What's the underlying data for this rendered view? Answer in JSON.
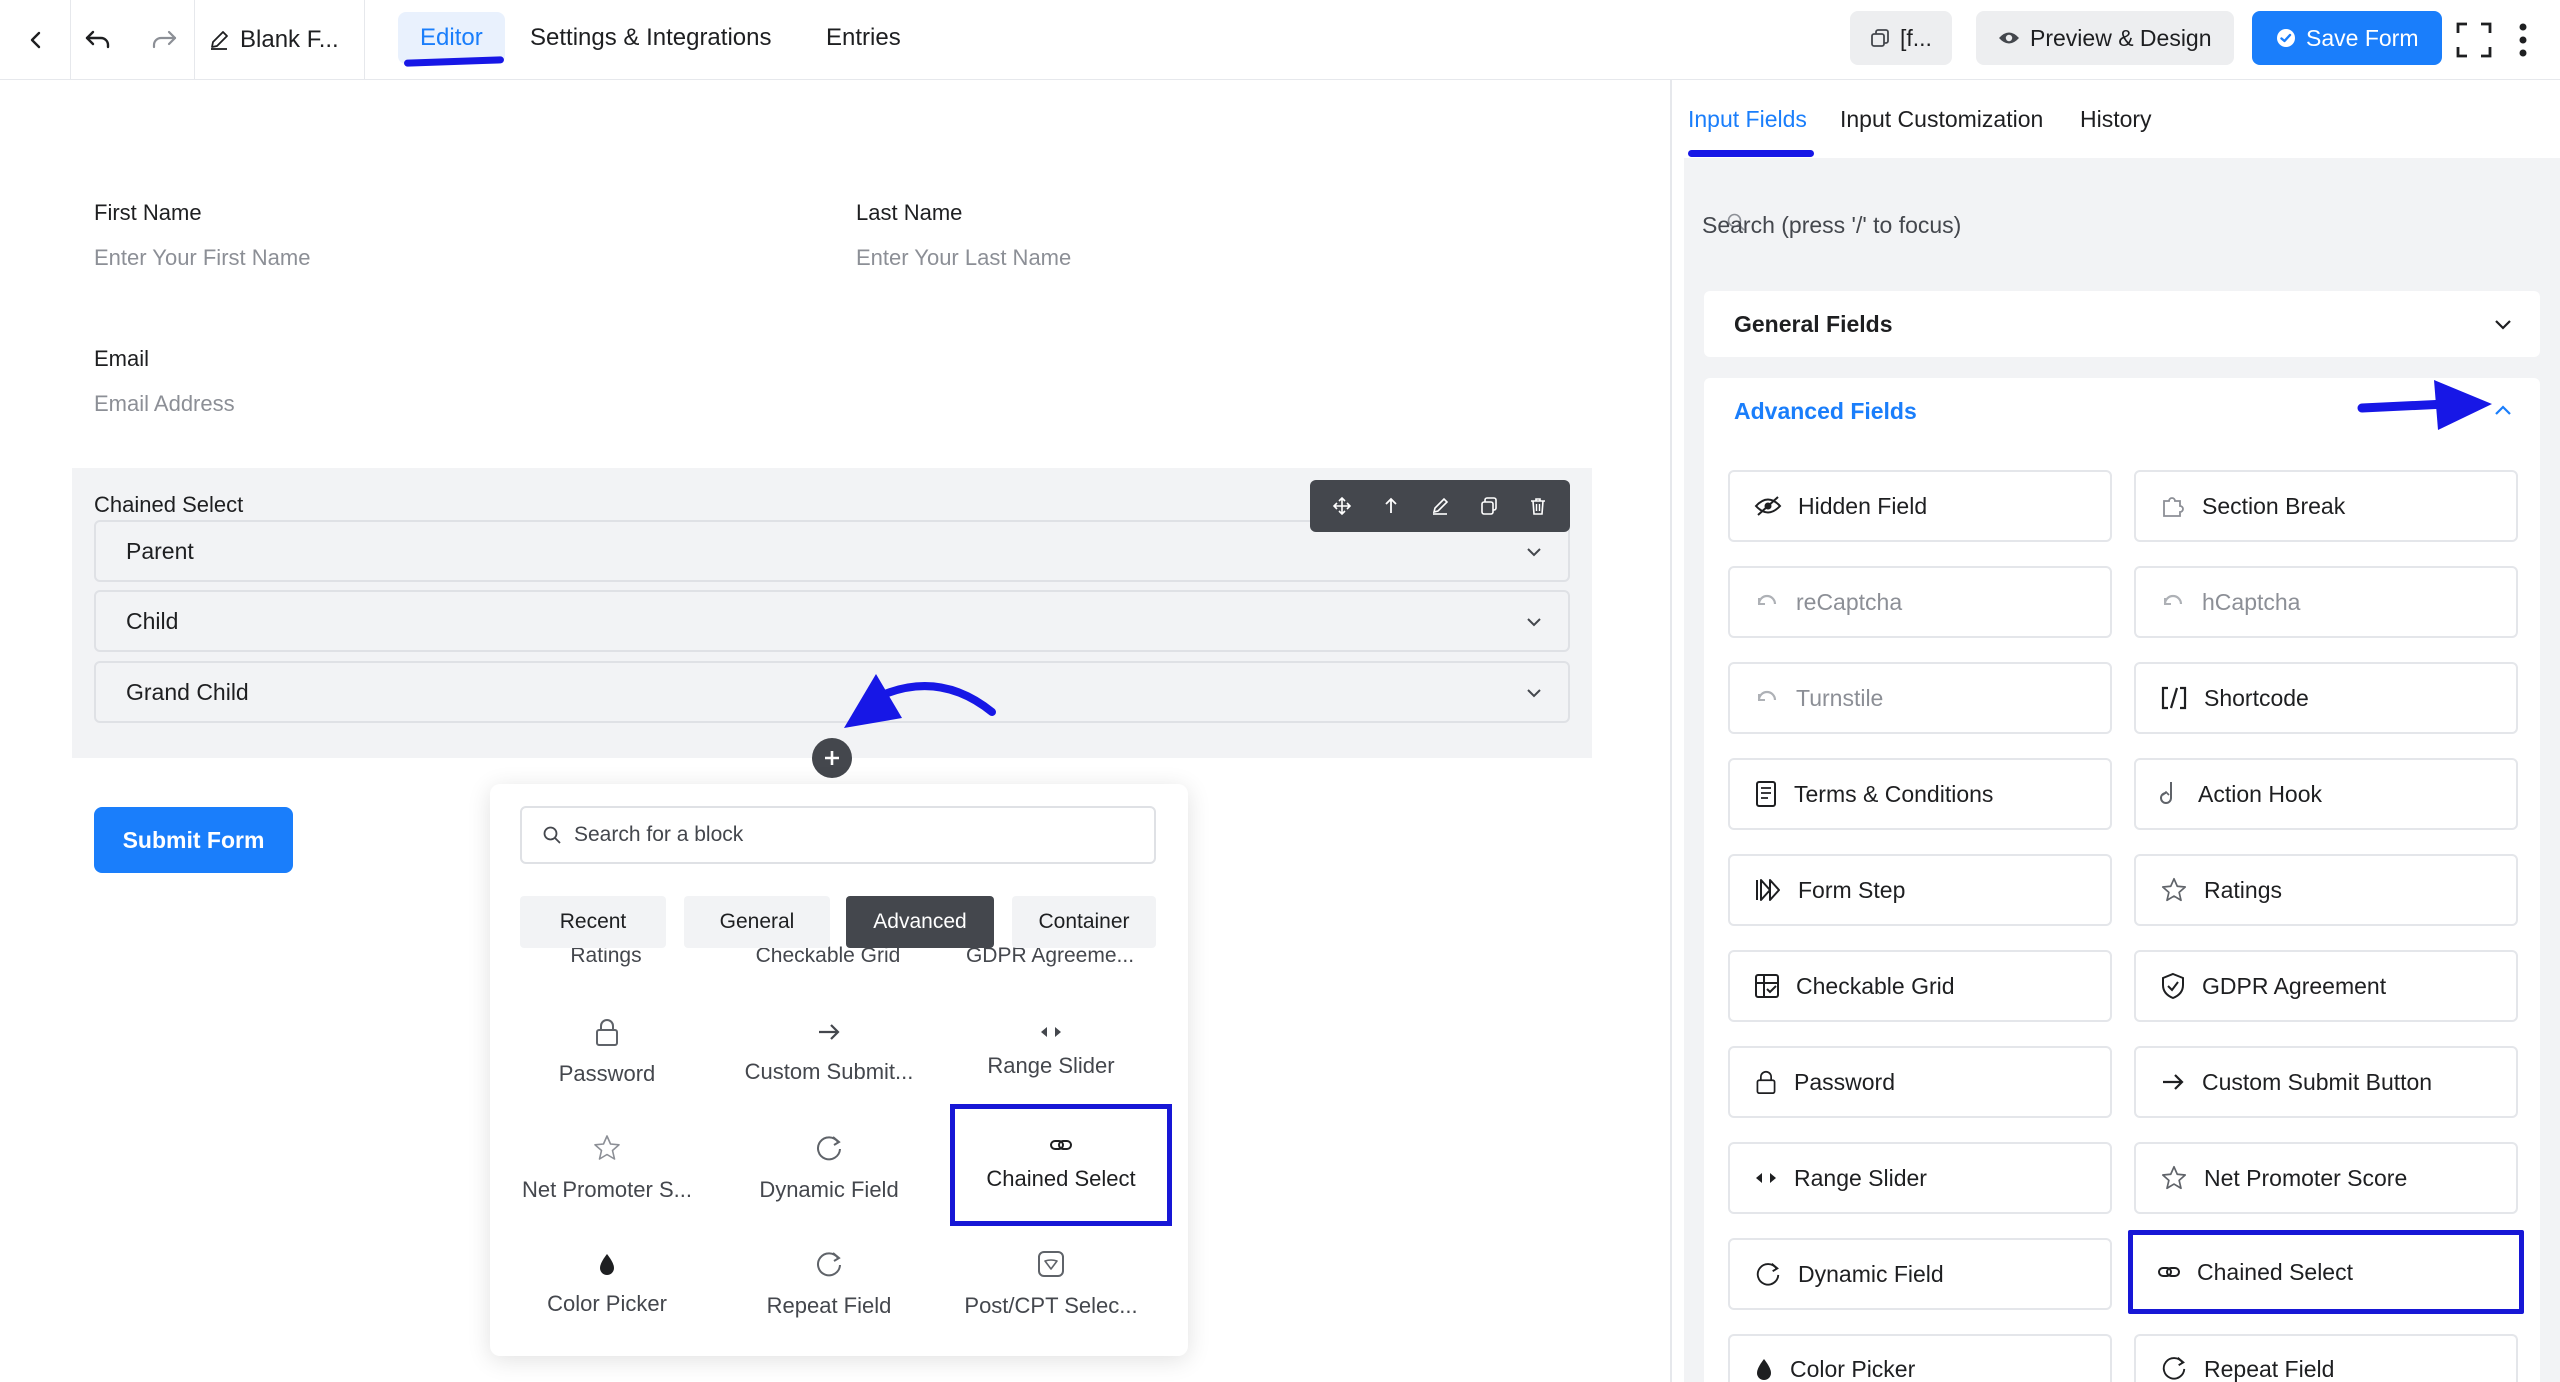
{
  "topbar": {
    "form_title": "Blank F...",
    "tabs": [
      "Editor",
      "Settings & Integrations",
      "Entries"
    ],
    "shortcode_label": "[f...",
    "preview_label": "Preview & Design",
    "save_label": "Save Form"
  },
  "form": {
    "first_name_label": "First Name",
    "first_name_placeholder": "Enter Your First Name",
    "last_name_label": "Last Name",
    "last_name_placeholder": "Enter Your Last Name",
    "email_label": "Email",
    "email_placeholder": "Email Address",
    "chained_label": "Chained Select",
    "selects": [
      "Parent",
      "Child",
      "Grand Child"
    ],
    "submit_label": "Submit Form"
  },
  "popup": {
    "search_placeholder": "Search for a block",
    "tabs": [
      "Recent",
      "General",
      "Advanced",
      "Container"
    ],
    "active_tab": "Advanced",
    "clipped_row": [
      "Ratings",
      "Checkable Grid",
      "GDPR Agreeme..."
    ],
    "items": [
      {
        "label": "Password",
        "icon": "lock-icon"
      },
      {
        "label": "Custom Submit...",
        "icon": "arrow-right-icon"
      },
      {
        "label": "Range Slider",
        "icon": "range-slider-icon"
      },
      {
        "label": "Net Promoter S...",
        "icon": "star-icon"
      },
      {
        "label": "Dynamic Field",
        "icon": "refresh-icon"
      },
      {
        "label": "Chained Select",
        "icon": "link-icon"
      },
      {
        "label": "Color Picker",
        "icon": "drop-icon"
      },
      {
        "label": "Repeat Field",
        "icon": "refresh-icon"
      },
      {
        "label": "Post/CPT Selec...",
        "icon": "post-select-icon"
      }
    ]
  },
  "sidebar": {
    "tabs": [
      "Input Fields",
      "Input Customization",
      "History"
    ],
    "search_placeholder": "Search (press '/' to focus)",
    "general_fields": "General Fields",
    "advanced_fields": "Advanced Fields",
    "items": [
      {
        "label": "Hidden Field",
        "icon": "eye-slash-icon",
        "disabled": false
      },
      {
        "label": "Section Break",
        "icon": "puzzle-icon",
        "disabled": false
      },
      {
        "label": "reCaptcha",
        "icon": "captcha-icon",
        "disabled": true
      },
      {
        "label": "hCaptcha",
        "icon": "captcha-icon",
        "disabled": true
      },
      {
        "label": "Turnstile",
        "icon": "captcha-icon",
        "disabled": true
      },
      {
        "label": "Shortcode",
        "icon": "shortcode-icon",
        "disabled": false
      },
      {
        "label": "Terms & Conditions",
        "icon": "document-icon",
        "disabled": false
      },
      {
        "label": "Action Hook",
        "icon": "hook-icon",
        "disabled": false
      },
      {
        "label": "Form Step",
        "icon": "step-icon",
        "disabled": false
      },
      {
        "label": "Ratings",
        "icon": "star-icon",
        "disabled": false
      },
      {
        "label": "Checkable Grid",
        "icon": "grid-icon",
        "disabled": false
      },
      {
        "label": "GDPR Agreement",
        "icon": "shield-icon",
        "disabled": false
      },
      {
        "label": "Password",
        "icon": "lock-icon",
        "disabled": false
      },
      {
        "label": "Custom Submit Button",
        "icon": "arrow-right-icon",
        "disabled": false
      },
      {
        "label": "Range Slider",
        "icon": "range-slider-icon",
        "disabled": false
      },
      {
        "label": "Net Promoter Score",
        "icon": "star-icon",
        "disabled": false
      },
      {
        "label": "Dynamic Field",
        "icon": "refresh-icon",
        "disabled": false
      },
      {
        "label": "Chained Select",
        "icon": "link-icon",
        "disabled": false
      },
      {
        "label": "Color Picker",
        "icon": "drop-icon",
        "disabled": false
      },
      {
        "label": "Repeat Field",
        "icon": "refresh-icon",
        "disabled": false
      }
    ]
  },
  "colors": {
    "accent": "#1a7efb",
    "annotation": "#1717e6"
  }
}
